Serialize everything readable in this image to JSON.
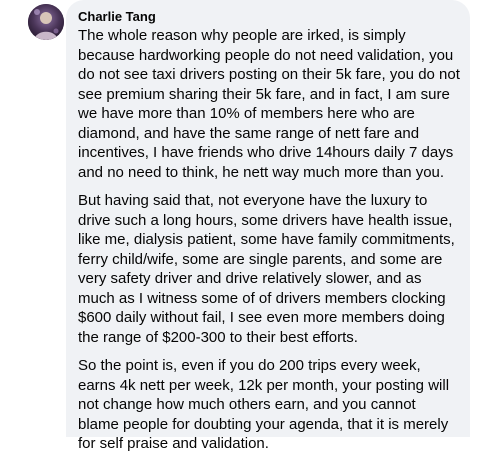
{
  "comment": {
    "avatar_icon": "profile-photo",
    "author": "Charlie Tang",
    "paragraphs": [
      "The whole reason why people are irked, is simply because hardworking people do not need validation, you do not see taxi drivers posting on their 5k fare, you do not see premium sharing their 5k fare, and in fact, I am sure we have more than 10% of members here who are diamond, and have the same range of nett fare and incentives, I have friends who drive 14hours daily 7 days and no need to think, he nett way much more than you.",
      "But having said that, not everyone have the luxury to drive such a long hours, some drivers have health issue, like me, dialysis patient, some have family commitments, ferry child/wife, some are single parents, and some are very safety driver and drive relatively slower, and as much as I witness some of of drivers members clocking $600 daily without fail, I see even more members doing the range of $200-300 to their best efforts.",
      "So the point is, even if you do 200 trips every week, earns 4k nett per week, 12k per month, your posting will not change how much others earn, and you cannot blame people for doubting your agenda, that it is merely for self praise and validation."
    ]
  },
  "colors": {
    "bubble_bg": "#f0f2f5",
    "text": "#050505"
  }
}
